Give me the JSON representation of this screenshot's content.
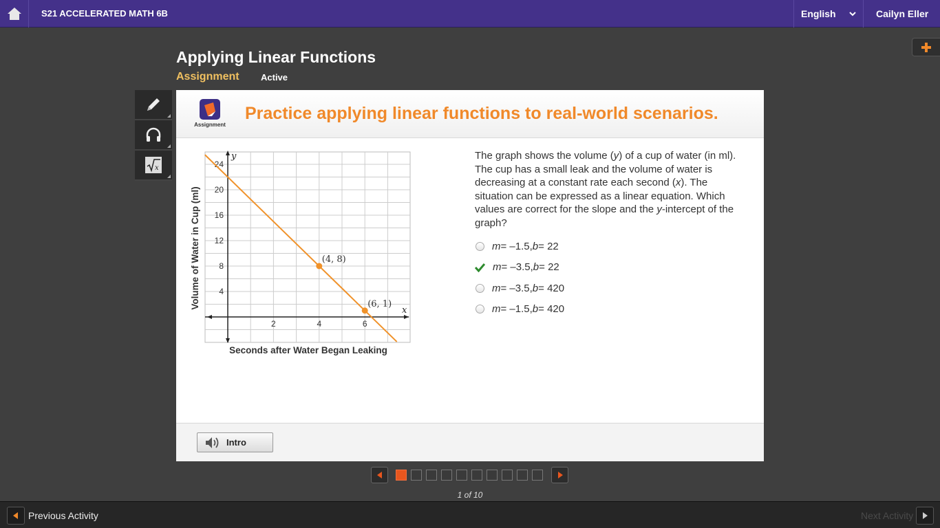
{
  "topbar": {
    "course_title": "S21 ACCELERATED MATH 6B",
    "language": "English",
    "user_name": "Cailyn Eller"
  },
  "page": {
    "title": "Applying Linear Functions",
    "type_label": "Assignment",
    "status": "Active"
  },
  "tools": [
    "pencil-icon",
    "headphones-icon",
    "calculator-icon"
  ],
  "card": {
    "logo_caption": "Assignment",
    "heading": "Practice applying linear functions to real-world scenarios.",
    "question_parts": [
      "The graph shows the volume (",
      "y",
      ") of a cup of water (in ml). The cup has a small leak and the volume of water is decreasing at a constant rate each second (",
      "x",
      "). The situation can be expressed as a linear equation. Which values are correct for the slope and the ",
      "y",
      "-intercept of the graph?"
    ],
    "choices": [
      {
        "m": "m",
        "eq1": " = –1.5, ",
        "b": "b",
        "eq2": " = 22",
        "selected": false
      },
      {
        "m": "m",
        "eq1": " = –3.5, ",
        "b": "b",
        "eq2": " = 22",
        "selected": true
      },
      {
        "m": "m",
        "eq1": " = –3.5, ",
        "b": "b",
        "eq2": " = 420",
        "selected": false
      },
      {
        "m": "m",
        "eq1": " = –1.5, ",
        "b": "b",
        "eq2": " = 420",
        "selected": false
      }
    ],
    "intro_label": "Intro"
  },
  "graph": {
    "ylabel": "Volume of Water in Cup (ml)",
    "xlabel": "Seconds after Water Began Leaking",
    "x_axis_letter": "x",
    "y_axis_letter": "y",
    "x_ticks": [
      "2",
      "4",
      "6"
    ],
    "y_ticks": [
      "4",
      "8",
      "12",
      "16",
      "20",
      "24"
    ],
    "points": [
      {
        "label": "(4, 8)",
        "x": 4,
        "y": 8
      },
      {
        "label": "(6, 1)",
        "x": 6,
        "y": 1
      }
    ],
    "line_color": "#f0922a"
  },
  "pager": {
    "current": 1,
    "total": 10,
    "count_text": "1 of 10"
  },
  "bottombar": {
    "prev_label": "Previous Activity",
    "next_label": "Next Activity"
  },
  "colors": {
    "topbar": "#44318a",
    "accent": "#f0892a",
    "active_dot": "#e8561e",
    "check": "#2e8b2e"
  }
}
